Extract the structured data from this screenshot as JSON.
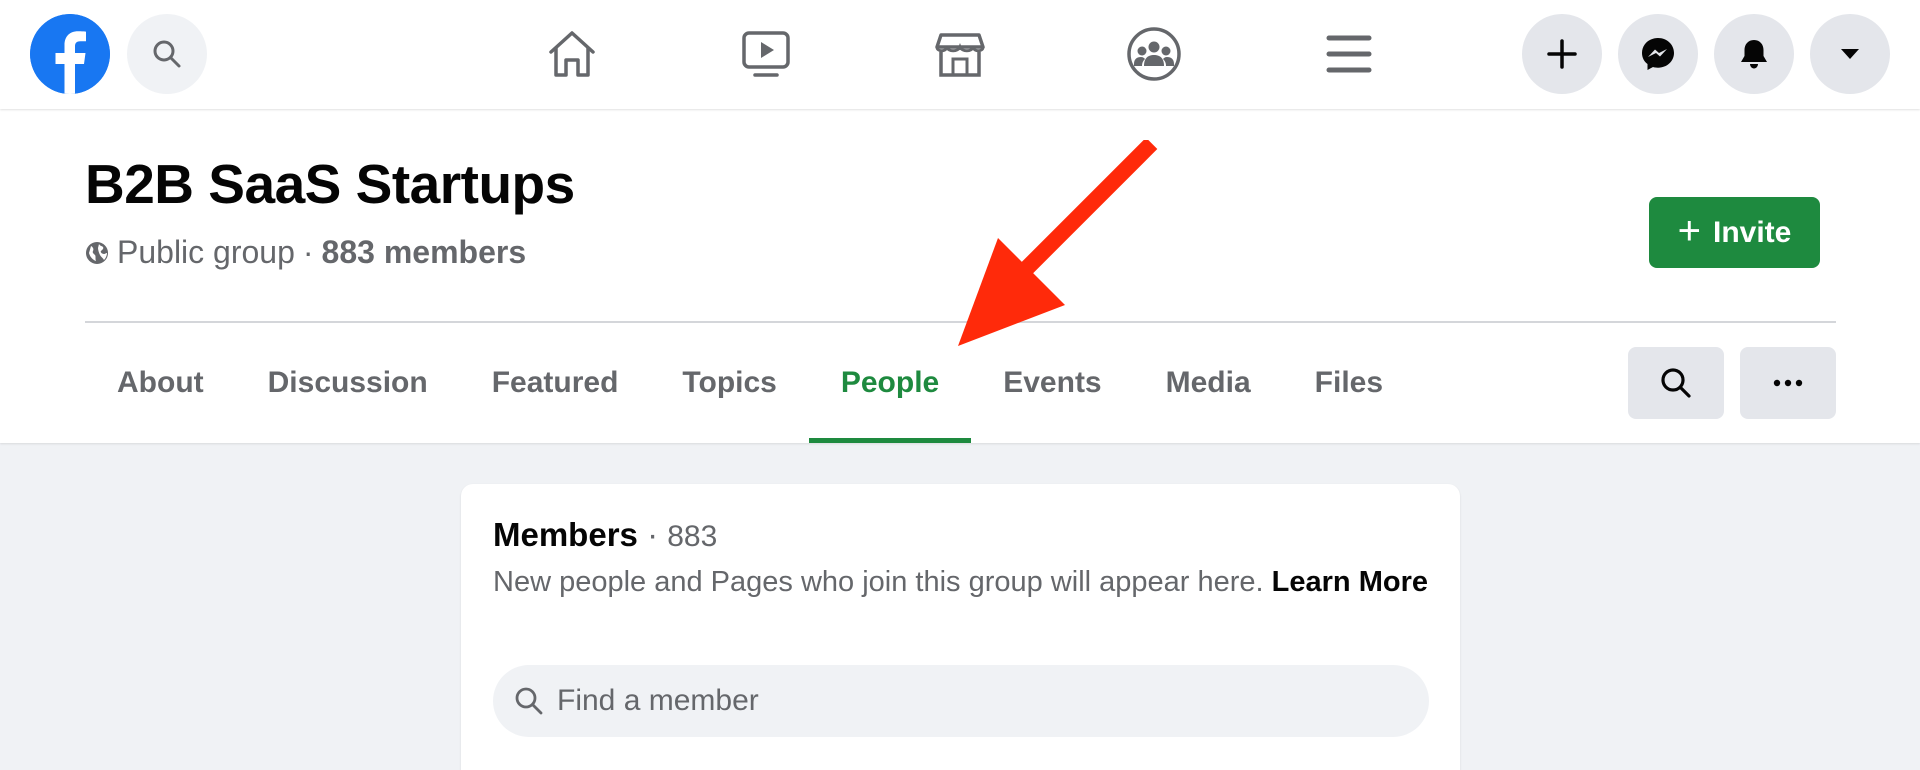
{
  "topbar": {
    "logo_icon": "facebook-logo",
    "search_icon": "search-icon",
    "nav_icons": [
      "home-icon",
      "watch-icon",
      "marketplace-icon",
      "groups-icon",
      "menu-icon"
    ],
    "action_icons": [
      "plus-icon",
      "messenger-icon",
      "bell-icon",
      "caret-down-icon"
    ]
  },
  "group": {
    "title": "B2B SaaS Startups",
    "privacy": "Public group",
    "separator": "·",
    "member_count": "883 members",
    "invite_label": "Invite"
  },
  "tabs": [
    {
      "label": "About"
    },
    {
      "label": "Discussion"
    },
    {
      "label": "Featured"
    },
    {
      "label": "Topics"
    },
    {
      "label": "People",
      "active": true
    },
    {
      "label": "Events"
    },
    {
      "label": "Media"
    },
    {
      "label": "Files"
    }
  ],
  "members_card": {
    "title": "Members",
    "separator": "·",
    "count": "883",
    "description": "New people and Pages who join this group will appear here.",
    "learn_more": "Learn More",
    "search_placeholder": "Find a member"
  },
  "colors": {
    "brand_blue": "#1877f2",
    "accent_green": "#1e8a3f",
    "annotation_red": "#ff2a0a"
  }
}
